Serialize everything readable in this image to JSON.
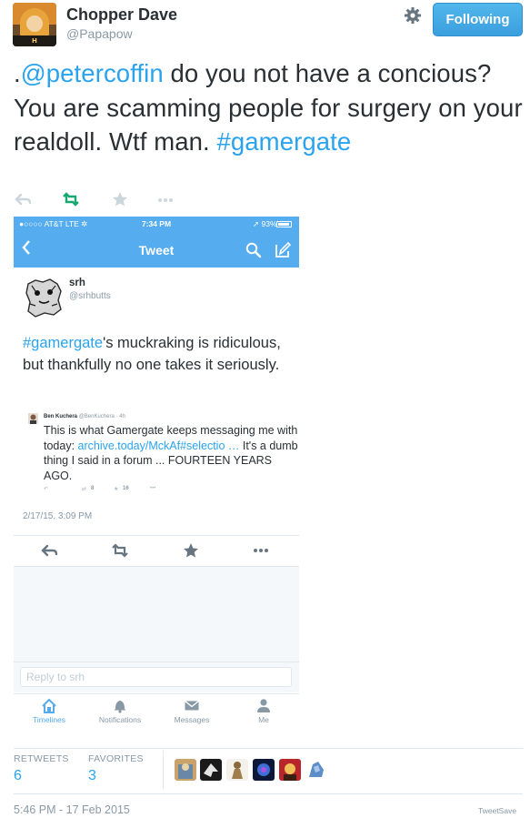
{
  "author": {
    "name": "Chopper Dave",
    "handle": "@Papapow",
    "avatar_banner_text": "H OOOOOOOH"
  },
  "follow_button": {
    "label": "Following"
  },
  "tweet": {
    "prefix": ".",
    "mention": "@petercoffin",
    "text": " do you not have a concious?  You are scamming people for surgery on your realdoll. Wtf man. ",
    "hashtag": "#gamergate"
  },
  "tweet_actions": [
    "reply-icon",
    "retweet-icon",
    "favorite-icon",
    "more-icon"
  ],
  "embedded_screenshot": {
    "status_bar": {
      "carrier": "●○○○○ AT&T  LTE  ✲",
      "time": "7:34 PM",
      "battery": "➚ 93%",
      "battery_level": 0.93
    },
    "nav_title": "Tweet",
    "inner_tweet": {
      "name": "srh",
      "handle": "@srhbutts",
      "hashtag": "#gamergate",
      "text": "'s muckraking is ridiculous, but thankfully no one takes it seriously.",
      "date": "2/17/15, 3:09 PM"
    },
    "quoted_tweet": {
      "name": "Ben Kuchera",
      "handle": "@BenKuchera · 4h",
      "text_before": "This is what Gamergate keeps messaging me with today: ",
      "link": "archive.today/MckAf#selectio …",
      "text_after": " It's a dumb thing I said in a forum ... FOURTEEN YEARS AGO.",
      "retweets": "8",
      "favorites": "16"
    },
    "reply_placeholder": "Reply to srh",
    "tabs": [
      {
        "label": "Timelines",
        "icon": "home-icon"
      },
      {
        "label": "Notifications",
        "icon": "bell-icon"
      },
      {
        "label": "Messages",
        "icon": "envelope-icon"
      },
      {
        "label": "Me",
        "icon": "person-icon"
      }
    ]
  },
  "stats": {
    "retweets_label": "RETWEETS",
    "retweets_count": "6",
    "favorites_label": "FAVORITES",
    "favorites_count": "3"
  },
  "timestamp": "5:46 PM - 17 Feb 2015",
  "watermark": "TweetSave",
  "colors": {
    "link": "#2aa3ef",
    "twitter_blue": "#55acee",
    "muted": "#8899a6",
    "text": "#292f33"
  }
}
